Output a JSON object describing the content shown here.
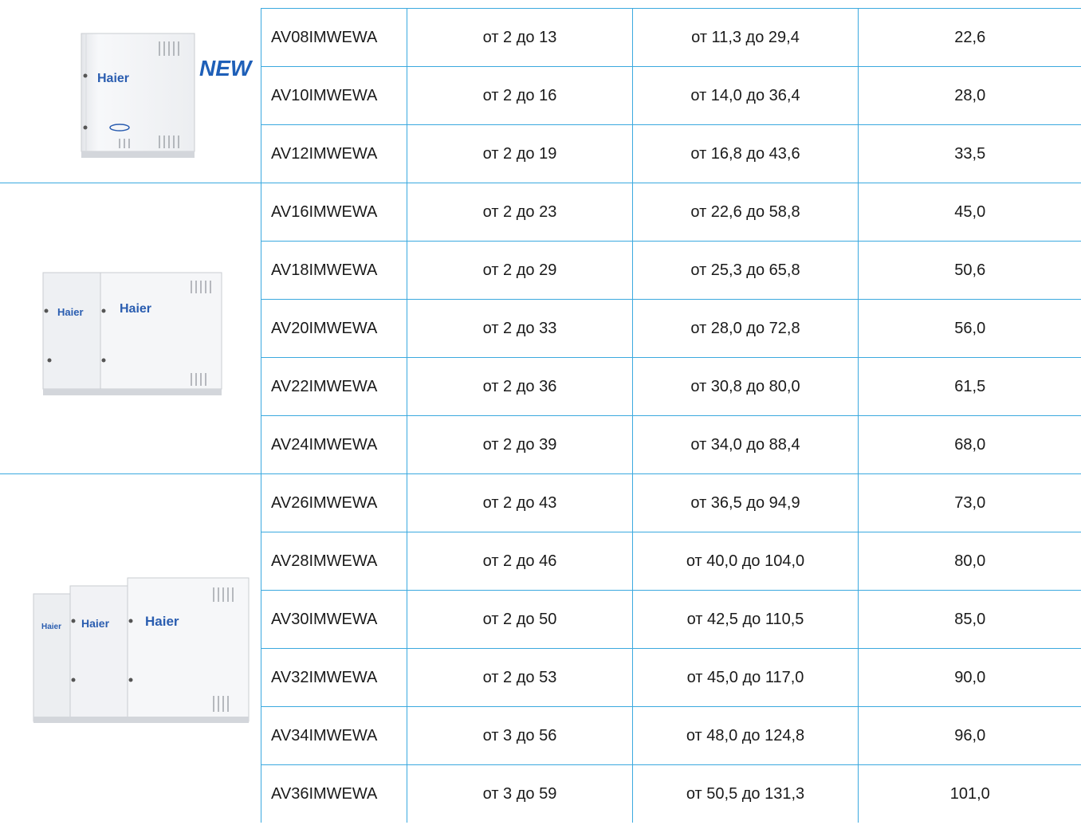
{
  "brand": {
    "logo_text": "Haier",
    "new_badge": "NEW"
  },
  "colors": {
    "grid_line": "#3ba9df",
    "brand_blue": "#2a5db0",
    "unit_body": "#f3f4f6"
  },
  "groups": [
    {
      "image": "single-module-unit-icon",
      "rows": 3
    },
    {
      "image": "double-module-unit-icon",
      "rows": 5
    },
    {
      "image": "triple-module-unit-icon",
      "rows": 6
    }
  ],
  "rows": [
    {
      "model": "AV08IMWEWA",
      "units": "от 2 до 13",
      "capacity": "от 11,3 до 29,4",
      "value": "22,6"
    },
    {
      "model": "AV10IMWEWA",
      "units": "от 2 до 16",
      "capacity": "от 14,0 до 36,4",
      "value": "28,0"
    },
    {
      "model": "AV12IMWEWA",
      "units": "от 2 до 19",
      "capacity": "от 16,8 до 43,6",
      "value": "33,5"
    },
    {
      "model": "AV16IMWEWA",
      "units": "от 2 до 23",
      "capacity": "от 22,6 до 58,8",
      "value": "45,0"
    },
    {
      "model": "AV18IMWEWA",
      "units": "от 2 до 29",
      "capacity": "от 25,3 до 65,8",
      "value": "50,6"
    },
    {
      "model": "AV20IMWEWA",
      "units": "от 2 до 33",
      "capacity": "от 28,0 до 72,8",
      "value": "56,0"
    },
    {
      "model": "AV22IMWEWA",
      "units": "от 2 до 36",
      "capacity": "от 30,8 до 80,0",
      "value": "61,5"
    },
    {
      "model": "AV24IMWEWA",
      "units": "от 2 до 39",
      "capacity": "от 34,0 до 88,4",
      "value": "68,0"
    },
    {
      "model": "AV26IMWEWA",
      "units": "от 2 до 43",
      "capacity": "от 36,5 до 94,9",
      "value": "73,0"
    },
    {
      "model": "AV28IMWEWA",
      "units": "от 2 до 46",
      "capacity": "от 40,0 до 104,0",
      "value": "80,0"
    },
    {
      "model": "AV30IMWEWA",
      "units": "от 2 до 50",
      "capacity": "от 42,5 до 110,5",
      "value": "85,0"
    },
    {
      "model": "AV32IMWEWA",
      "units": "от 2 до 53",
      "capacity": "от 45,0 до 117,0",
      "value": "90,0"
    },
    {
      "model": "AV34IMWEWA",
      "units": "от 3 до 56",
      "capacity": "от 48,0 до 124,8",
      "value": "96,0"
    },
    {
      "model": "AV36IMWEWA",
      "units": "от 3 до 59",
      "capacity": "от 50,5 до 131,3",
      "value": "101,0"
    }
  ]
}
